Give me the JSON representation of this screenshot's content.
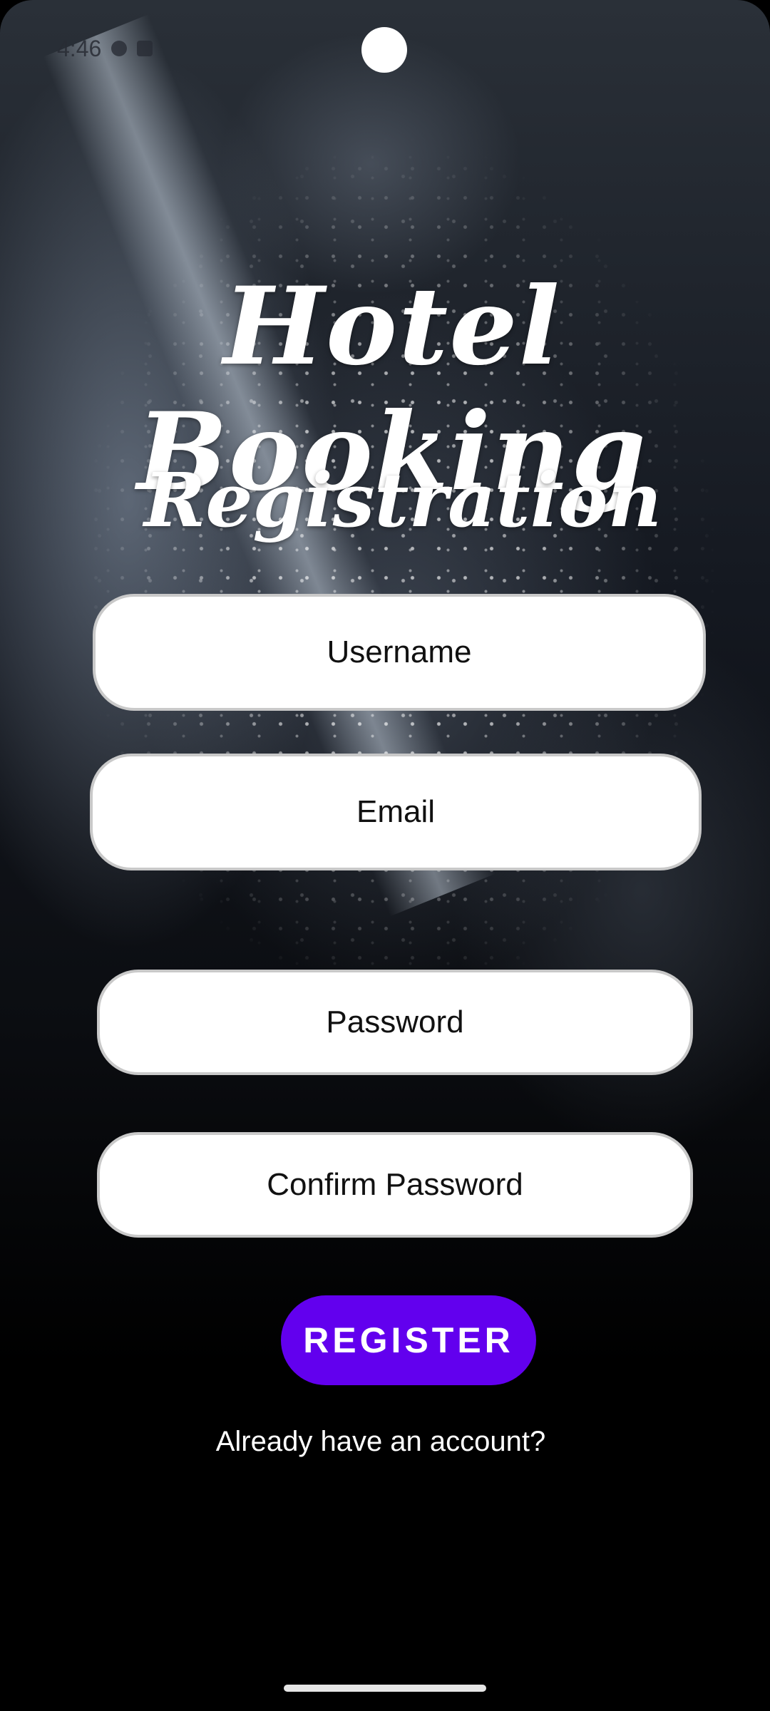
{
  "status_bar": {
    "time": "4:46"
  },
  "header": {
    "title": "Hotel Booking",
    "subtitle": "Registration"
  },
  "form": {
    "username_placeholder": "Username",
    "email_placeholder": "Email",
    "password_placeholder": "Password",
    "confirm_password_placeholder": "Confirm Password",
    "register_label": "REGISTER",
    "login_link": "Already have an account?"
  },
  "colors": {
    "accent": "#6200ee",
    "field_background": "#ffffff",
    "field_border": "#c9c9c9",
    "text_on_dark": "#ffffff"
  }
}
